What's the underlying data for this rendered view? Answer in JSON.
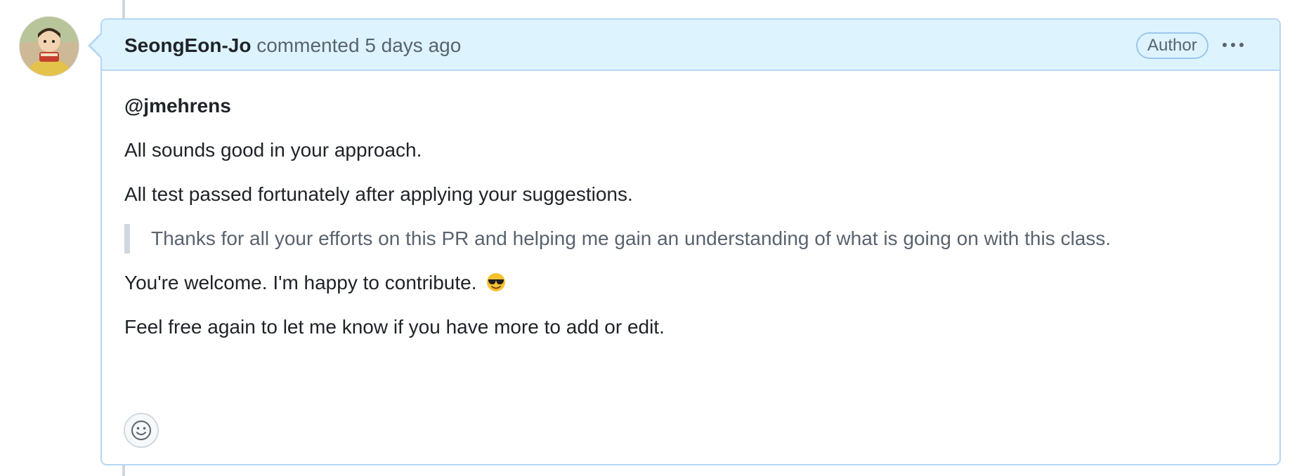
{
  "comment": {
    "author": "SeongEon-Jo",
    "action": "commented",
    "time": "5 days ago",
    "badge": "Author",
    "menu_icon": "kebab-horizontal-icon",
    "mention": "@jmehrens",
    "paragraphs": [
      "All sounds good in your approach.",
      "All test passed fortunately after applying your suggestions."
    ],
    "quote": "Thanks for all your efforts on this PR and helping me gain an understanding of what is going on with this class.",
    "reply": "You're welcome. I'm happy to contribute.",
    "reply_emoji": "smiling-face-with-sunglasses-emoji",
    "closing": "Feel free again to let me know if you have more to add or edit.",
    "reaction_icon": "smiley-icon"
  },
  "colors": {
    "header_bg": "#ddf4ff",
    "border": "#b6d7f3",
    "text": "#1f2328",
    "muted": "#59636e"
  }
}
